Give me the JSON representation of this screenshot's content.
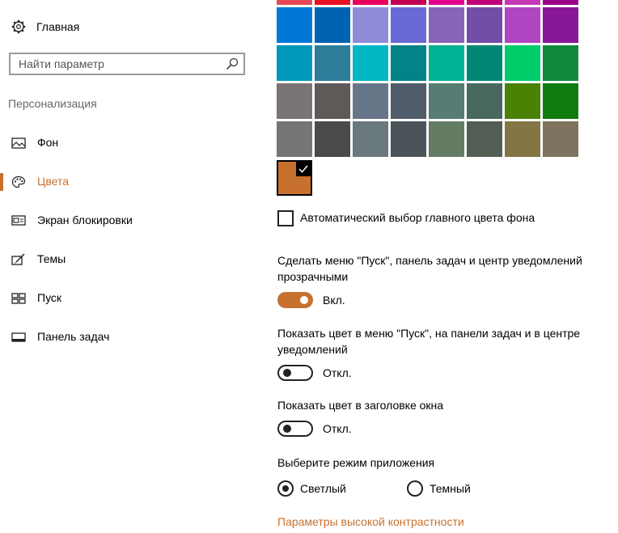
{
  "colors": {
    "accent": "#c8702e",
    "text": "#000000",
    "muted": "#666666"
  },
  "sidebar": {
    "home": {
      "label": "Главная",
      "icon": "gear-icon"
    },
    "search": {
      "placeholder": "Найти параметр",
      "icon": "search-icon"
    },
    "section_title": "Персонализация",
    "items": [
      {
        "label": "Фон",
        "icon": "image-icon",
        "active": false
      },
      {
        "label": "Цвета",
        "icon": "palette-icon",
        "active": true
      },
      {
        "label": "Экран блокировки",
        "icon": "lock-screen-icon",
        "active": false
      },
      {
        "label": "Темы",
        "icon": "themes-icon",
        "active": false
      },
      {
        "label": "Пуск",
        "icon": "start-icon",
        "active": false
      },
      {
        "label": "Панель задач",
        "icon": "taskbar-icon",
        "active": false
      }
    ]
  },
  "palette": {
    "rows": [
      [
        "#e74856",
        "#e81123",
        "#ea005e",
        "#c30052",
        "#e3008c",
        "#bf0077",
        "#c239b3",
        "#9a0089"
      ],
      [
        "#0078d7",
        "#0063b1",
        "#8e8cd8",
        "#6b69d6",
        "#8764b8",
        "#744da9",
        "#b146c2",
        "#881798"
      ],
      [
        "#0099bc",
        "#2d7d9a",
        "#00b7c3",
        "#038387",
        "#00b294",
        "#018574",
        "#00cc6a",
        "#10893e"
      ],
      [
        "#7a7574",
        "#5d5a58",
        "#68768a",
        "#515c6b",
        "#567c73",
        "#486860",
        "#498205",
        "#107c10"
      ],
      [
        "#767676",
        "#4c4a48",
        "#69797e",
        "#4a5459",
        "#647c64",
        "#525e54",
        "#847545",
        "#7e735f"
      ]
    ],
    "selected_color": "#c8702e"
  },
  "main": {
    "auto_color": {
      "label": "Автоматический выбор главного цвета фона",
      "checked": false
    },
    "transparency": {
      "label": "Сделать меню \"Пуск\", панель задач и центр уведомлений прозрачными",
      "state": "Вкл."
    },
    "show_color_start": {
      "label": "Показать цвет в меню \"Пуск\", на панели задач и в центре уведомлений",
      "state": "Откл."
    },
    "show_color_title": {
      "label": "Показать цвет в заголовке окна",
      "state": "Откл."
    },
    "app_mode": {
      "label": "Выберите режим приложения",
      "options": [
        {
          "label": "Светлый",
          "selected": true
        },
        {
          "label": "Темный",
          "selected": false
        }
      ]
    },
    "high_contrast_link": "Параметры высокой контрастности"
  }
}
